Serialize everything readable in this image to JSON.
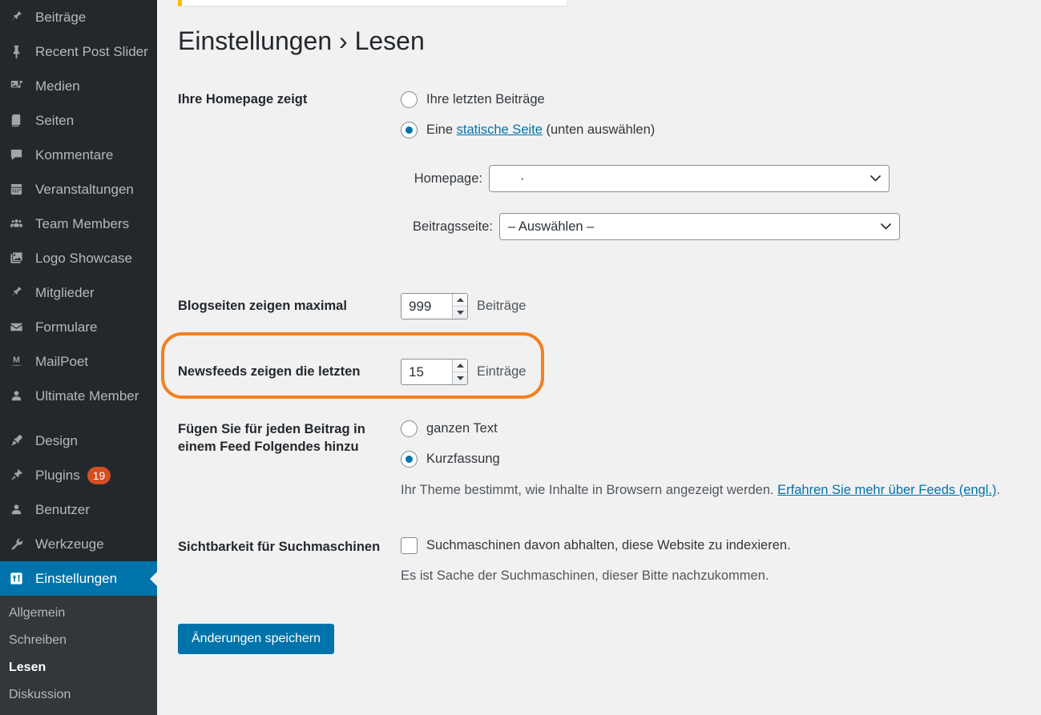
{
  "sidebar": {
    "items": [
      {
        "label": "Beiträge",
        "icon": "pin-icon",
        "name": "posts",
        "current": false,
        "badge": null
      },
      {
        "label": "Recent Post Slider",
        "icon": "pushpin-icon",
        "name": "recent-post-slider",
        "current": false,
        "badge": null
      },
      {
        "label": "Medien",
        "icon": "media-icon",
        "name": "media",
        "current": false,
        "badge": null
      },
      {
        "label": "Seiten",
        "icon": "pages-icon",
        "name": "pages",
        "current": false,
        "badge": null
      },
      {
        "label": "Kommentare",
        "icon": "comment-icon",
        "name": "comments",
        "current": false,
        "badge": null
      },
      {
        "label": "Veranstaltungen",
        "icon": "calendar-icon",
        "name": "events",
        "current": false,
        "badge": null
      },
      {
        "label": "Team Members",
        "icon": "group-icon",
        "name": "team-members",
        "current": false,
        "badge": null
      },
      {
        "label": "Logo Showcase",
        "icon": "images-icon",
        "name": "logo-showcase",
        "current": false,
        "badge": null
      },
      {
        "label": "Mitglieder",
        "icon": "pin-icon",
        "name": "mitglieder",
        "current": false,
        "badge": null
      },
      {
        "label": "Formulare",
        "icon": "envelope-icon",
        "name": "formulare",
        "current": false,
        "badge": null
      },
      {
        "label": "MailPoet",
        "icon": "mailpoet-icon",
        "name": "mailpoet",
        "current": false,
        "badge": null
      },
      {
        "label": "Ultimate Member",
        "icon": "user-icon",
        "name": "ultimate-member",
        "current": false,
        "badge": null
      },
      {
        "label": "Design",
        "icon": "brush-icon",
        "name": "design",
        "current": false,
        "badge": null,
        "separator": true
      },
      {
        "label": "Plugins",
        "icon": "plug-icon",
        "name": "plugins",
        "current": false,
        "badge": "19"
      },
      {
        "label": "Benutzer",
        "icon": "user-icon",
        "name": "users",
        "current": false,
        "badge": null
      },
      {
        "label": "Werkzeuge",
        "icon": "wrench-icon",
        "name": "tools",
        "current": false,
        "badge": null
      },
      {
        "label": "Einstellungen",
        "icon": "settings-icon",
        "name": "settings",
        "current": true,
        "badge": null
      }
    ],
    "submenu": [
      {
        "label": "Allgemein",
        "name": "allgemein",
        "current": false
      },
      {
        "label": "Schreiben",
        "name": "schreiben",
        "current": false
      },
      {
        "label": "Lesen",
        "name": "lesen",
        "current": true
      },
      {
        "label": "Diskussion",
        "name": "diskussion",
        "current": false
      }
    ]
  },
  "page": {
    "title": "Einstellungen › Lesen"
  },
  "settings": {
    "homepage_display": {
      "label": "Ihre Homepage zeigt",
      "options": [
        {
          "label": "Ihre letzten Beiträge",
          "selected": false
        },
        {
          "label_before": "Eine ",
          "link": "statische Seite",
          "label_after": " (unten auswählen)",
          "selected": true
        }
      ],
      "homepage_select": {
        "label": "Homepage:",
        "value": "·"
      },
      "posts_page_select": {
        "label": "Beitragsseite:",
        "value": "– Auswählen –"
      }
    },
    "posts_per_page": {
      "label": "Blogseiten zeigen maximal",
      "value": "999",
      "unit": "Beiträge"
    },
    "feed_items": {
      "label": "Newsfeeds zeigen die letzten",
      "value": "15",
      "unit": "Einträge"
    },
    "feed_content": {
      "label": "Fügen Sie für jeden Beitrag in einem Feed Folgendes hinzu",
      "options": [
        {
          "label": "ganzen Text",
          "selected": false
        },
        {
          "label": "Kurzfassung",
          "selected": true
        }
      ],
      "description_before": "Ihr Theme bestimmt, wie Inhalte in Browsern angezeigt werden. ",
      "description_link": "Erfahren Sie mehr über Feeds (engl.)",
      "description_after": "."
    },
    "search_visibility": {
      "label": "Sichtbarkeit für Suchmaschinen",
      "checkbox_label": "Suchmaschinen davon abhalten, diese Website zu indexieren.",
      "checked": false,
      "description": "Es ist Sache der Suchmaschinen, dieser Bitte nachzukommen."
    },
    "submit": {
      "label": "Änderungen speichern"
    }
  },
  "annotation": {
    "color": "#f28020",
    "target": "feed_items"
  },
  "colors": {
    "wp_blue": "#0073aa",
    "sidebar_bg": "#23282d",
    "submenu_bg": "#32373c",
    "badge": "#d54e21",
    "notice_accent": "#ffb900",
    "annotation": "#f28020"
  }
}
